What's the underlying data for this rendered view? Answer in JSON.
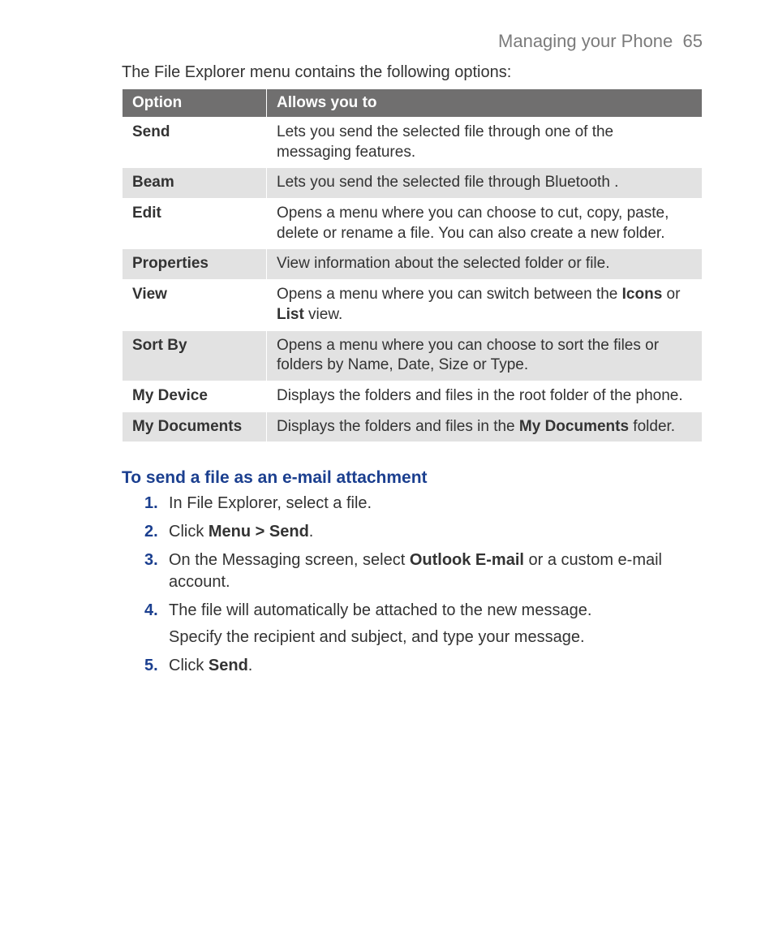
{
  "header": {
    "section_title": "Managing your Phone",
    "page_number": "65"
  },
  "intro": "The File Explorer menu contains the following options:",
  "table": {
    "headers": {
      "option": "Option",
      "allows": "Allows you to"
    },
    "rows": [
      {
        "option": "Send",
        "allows_pre": "Lets you send the selected file through one of the messaging features."
      },
      {
        "option": "Beam",
        "allows_pre": "Lets you send the selected file through Bluetooth ."
      },
      {
        "option": "Edit",
        "allows_pre": "Opens a menu where you can choose to cut, copy, paste, delete or rename a file. You can also create a new folder."
      },
      {
        "option": "Properties",
        "allows_pre": "View information about the selected folder or file."
      },
      {
        "option": "View",
        "allows_pre": "Opens a menu where you can switch between the ",
        "bold1": "Icons",
        "mid": " or ",
        "bold2": "List",
        "allows_post": " view."
      },
      {
        "option": "Sort By",
        "allows_pre": "Opens a menu where you can choose to sort the files or folders by Name, Date, Size or Type."
      },
      {
        "option": "My Device",
        "allows_pre": "Displays the folders and files in the root folder of the phone."
      },
      {
        "option": "My Documents",
        "allows_pre": "Displays the folders and files in the ",
        "bold1": "My Documents",
        "allows_post": " folder."
      }
    ]
  },
  "section": {
    "heading": "To send a file as an e-mail attachment",
    "steps": [
      {
        "num": "1.",
        "pre": "In File Explorer, select a file."
      },
      {
        "num": "2.",
        "pre": "Click ",
        "bold1": "Menu > Send",
        "post": "."
      },
      {
        "num": "3.",
        "pre": "On the Messaging screen, select ",
        "bold1": "Outlook E-mail",
        "post": " or a custom e-mail account."
      },
      {
        "num": "4.",
        "pre": "The file will automatically be attached to the new message.",
        "extra": "Specify the recipient and subject, and type your message."
      },
      {
        "num": "5.",
        "pre": "Click ",
        "bold1": "Send",
        "post": "."
      }
    ]
  }
}
